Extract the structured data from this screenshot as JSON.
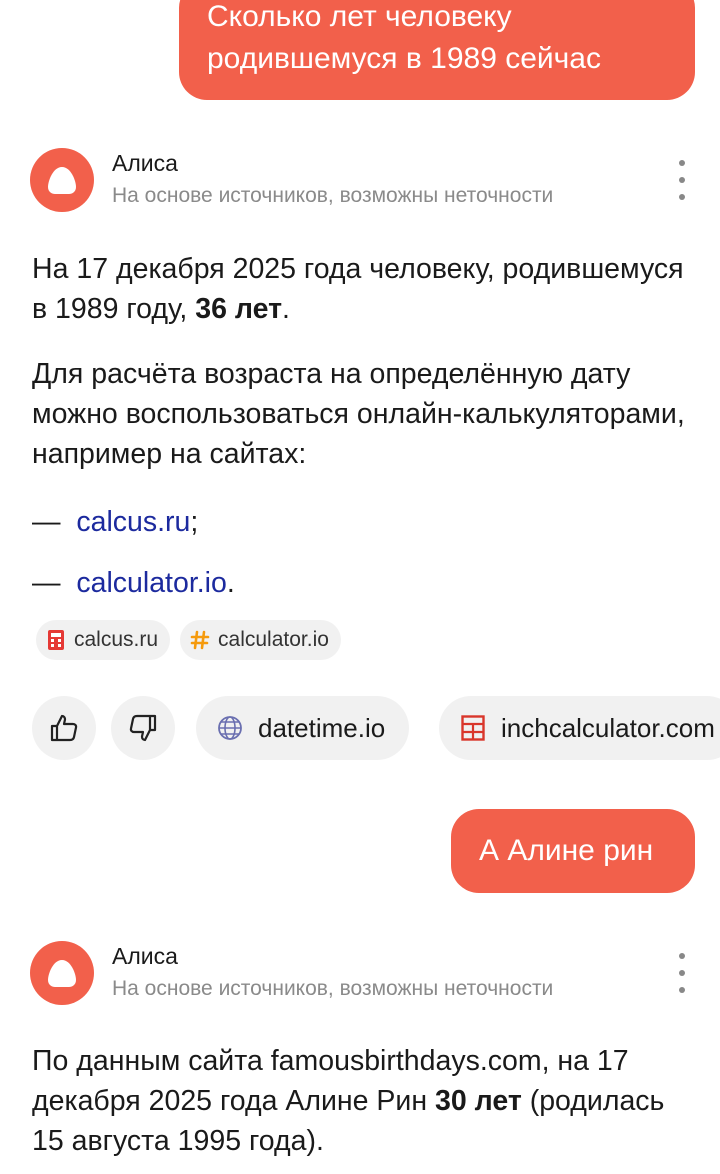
{
  "messages": {
    "user_1": "Сколько лет человеку родившемуся в 1989 сейчас",
    "user_2": "А Алине рин"
  },
  "assistant": {
    "name": "Алиса",
    "disclaimer": "На основе источников, возможны неточности"
  },
  "answer_1": {
    "p1_prefix": "На 17 декабря 2025 года человеку, родившемуся в 1989 году, ",
    "p1_bold": "36 лет",
    "p1_suffix": ".",
    "p2": "Для расчёта возраста на определённую дату можно воспользоваться онлайн-калькуляторами, например на сайтах:",
    "list": [
      {
        "dash": "—",
        "link": "calcus.ru",
        "suffix": ";"
      },
      {
        "dash": "—",
        "link": "calculator.io",
        "suffix": "."
      }
    ],
    "chips": [
      {
        "icon": "calculator-icon",
        "label": "calcus.ru"
      },
      {
        "icon": "hash-icon",
        "label": "calculator.io"
      }
    ],
    "sources": [
      {
        "icon": "globe-icon",
        "label": "datetime.io"
      },
      {
        "icon": "table-icon",
        "label": "inchcalculator.com"
      }
    ]
  },
  "answer_2": {
    "prefix": "По данным сайта famousbirthdays.com, на 17 декабря 2025 года Алине Рин ",
    "bold": "30 лет",
    "suffix": " (родилась 15 августа 1995 года)."
  },
  "colors": {
    "accent": "#f2604b",
    "link": "#1c2a9e",
    "muted": "#8a8a8a",
    "chip_bg": "#f1f1f1"
  }
}
